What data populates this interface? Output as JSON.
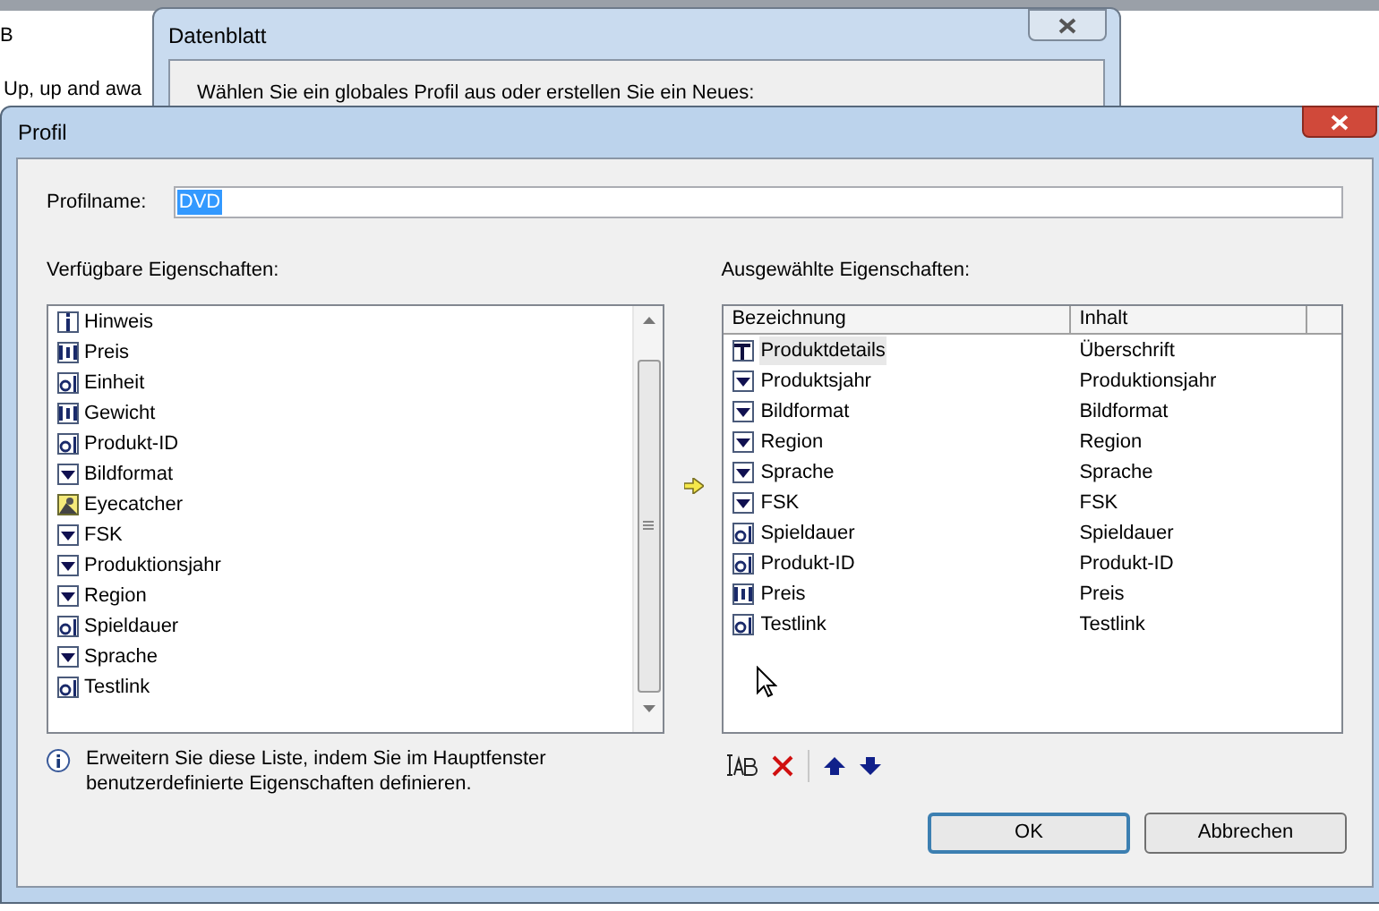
{
  "background": {
    "texts": [
      "B",
      "Up, up and awa"
    ]
  },
  "back_window": {
    "title": "Datenblatt",
    "prompt": "Wählen Sie ein globales Profil aus oder erstellen Sie ein Neues:"
  },
  "window": {
    "title": "Profil"
  },
  "profile_name": {
    "label": "Profilname:",
    "value": "DVD"
  },
  "available": {
    "label": "Verfügbare Eigenschaften:",
    "items": [
      {
        "kind": "info",
        "label": "Hinweis"
      },
      {
        "kind": "number",
        "label": "Preis"
      },
      {
        "kind": "text",
        "label": "Einheit"
      },
      {
        "kind": "number",
        "label": "Gewicht"
      },
      {
        "kind": "text",
        "label": "Produkt-ID"
      },
      {
        "kind": "list",
        "label": "Bildformat"
      },
      {
        "kind": "image",
        "label": "Eyecatcher"
      },
      {
        "kind": "list",
        "label": "FSK"
      },
      {
        "kind": "list",
        "label": "Produktionsjahr"
      },
      {
        "kind": "list",
        "label": "Region"
      },
      {
        "kind": "text",
        "label": "Spieldauer"
      },
      {
        "kind": "list",
        "label": "Sprache"
      },
      {
        "kind": "text",
        "label": "Testlink"
      }
    ]
  },
  "selected_props": {
    "label": "Ausgewählte Eigenschaften:",
    "columns": [
      "Bezeichnung",
      "Inhalt"
    ],
    "rows": [
      {
        "kind": "title",
        "name": "Produktdetails",
        "content": "Überschrift",
        "selected": true
      },
      {
        "kind": "list",
        "name": "Produktsjahr",
        "content": "Produktionsjahr",
        "selected": false
      },
      {
        "kind": "list",
        "name": "Bildformat",
        "content": "Bildformat",
        "selected": false
      },
      {
        "kind": "list",
        "name": "Region",
        "content": "Region",
        "selected": false
      },
      {
        "kind": "list",
        "name": "Sprache",
        "content": "Sprache",
        "selected": false
      },
      {
        "kind": "list",
        "name": "FSK",
        "content": "FSK",
        "selected": false
      },
      {
        "kind": "text",
        "name": "Spieldauer",
        "content": "Spieldauer",
        "selected": false
      },
      {
        "kind": "text",
        "name": "Produkt-ID",
        "content": "Produkt-ID",
        "selected": false
      },
      {
        "kind": "number",
        "name": "Preis",
        "content": "Preis",
        "selected": false
      },
      {
        "kind": "text",
        "name": "Testlink",
        "content": "Testlink",
        "selected": false
      }
    ]
  },
  "hint": "Erweitern Sie diese Liste, indem Sie im Hauptfenster benutzerdefinierte Eigenschaften definieren.",
  "buttons": [
    {
      "label": "OK",
      "default": true
    },
    {
      "label": "Abbrechen",
      "default": false
    }
  ]
}
